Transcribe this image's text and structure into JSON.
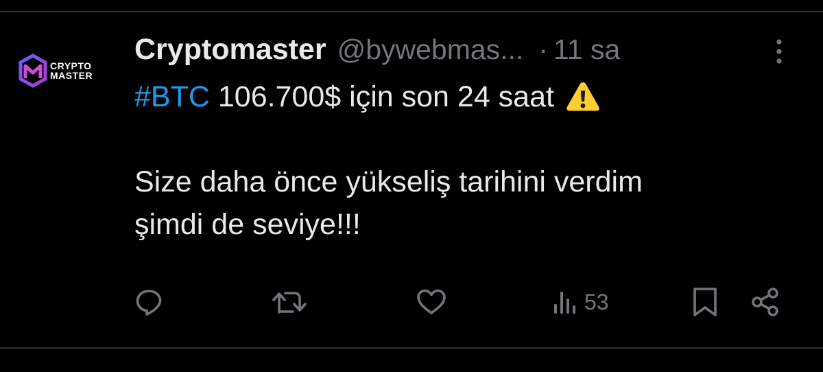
{
  "author": {
    "display_name": "Cryptomaster",
    "handle": "@bywebmas...",
    "separator": "·",
    "time": "11 sa",
    "avatar": {
      "line1": "CRYPTO",
      "line2": "MASTER",
      "icon": "cryptomaster-logo-icon"
    }
  },
  "tweet": {
    "hashtag": "#BTC",
    "line1_rest": " 106.700$ için son 24 saat",
    "line1_icon": "warning-icon",
    "line2": "Size daha önce yükseliş tarihini verdim",
    "line3": "şimdi de seviye!!!"
  },
  "actions": {
    "reply_icon": "reply-icon",
    "retweet_icon": "retweet-icon",
    "like_icon": "like-icon",
    "views_icon": "views-icon",
    "views_count": "53",
    "bookmark_icon": "bookmark-icon",
    "share_icon": "share-icon"
  },
  "colors": {
    "background": "#000000",
    "text": "#e7e9ea",
    "muted": "#71767b",
    "link": "#1d9bf0",
    "divider": "#2f3336"
  }
}
